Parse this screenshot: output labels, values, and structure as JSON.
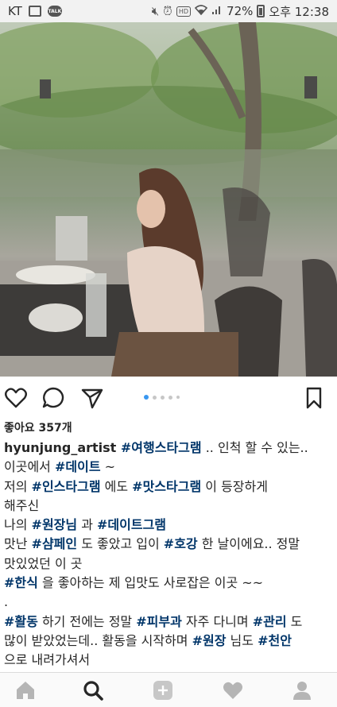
{
  "status_bar": {
    "carrier": "KT",
    "talk_badge": "TALK",
    "battery": "72%",
    "hd_label": "HD",
    "time": "오후 12:38",
    "icons": [
      "gallery-icon",
      "talk-icon",
      "mute-icon",
      "alarm-icon",
      "wifi-icon",
      "signal-icon",
      "battery-icon"
    ]
  },
  "post": {
    "carousel": {
      "count": 5,
      "active": 1
    },
    "likes": "좋아요 357개",
    "username": "hyunjung_artist",
    "caption_lines": [
      [
        {
          "t": "",
          "tag": false
        },
        {
          "t": "#여행스타그램",
          "tag": true
        },
        {
          "t": " .. 인척 할 수 있는..",
          "tag": false
        }
      ],
      [
        {
          "t": "이곳에서 ",
          "tag": false
        },
        {
          "t": "#데이트",
          "tag": true
        },
        {
          "t": " ~",
          "tag": false
        }
      ],
      [
        {
          "t": "저의 ",
          "tag": false
        },
        {
          "t": "#인스타그램",
          "tag": true
        },
        {
          "t": " 에도 ",
          "tag": false
        },
        {
          "t": "#맛스타그램",
          "tag": true
        },
        {
          "t": " 이 등장하게",
          "tag": false
        }
      ],
      [
        {
          "t": "해주신",
          "tag": false
        }
      ],
      [
        {
          "t": "나의 ",
          "tag": false
        },
        {
          "t": "#원장님",
          "tag": true
        },
        {
          "t": " 과 ",
          "tag": false
        },
        {
          "t": "#데이트그램",
          "tag": true
        }
      ],
      [
        {
          "t": "맛난 ",
          "tag": false
        },
        {
          "t": "#샴페인",
          "tag": true
        },
        {
          "t": " 도 좋았고 입이 ",
          "tag": false
        },
        {
          "t": "#호강",
          "tag": true
        },
        {
          "t": " 한 날이에요.. 정말",
          "tag": false
        }
      ],
      [
        {
          "t": "맛있었던 이 곳",
          "tag": false
        }
      ],
      [
        {
          "t": "#한식",
          "tag": true
        },
        {
          "t": " 을 좋아하는 제 입맛도 사로잡은 이곳 ~~",
          "tag": false
        }
      ],
      [
        {
          "t": ".",
          "tag": false
        }
      ],
      [
        {
          "t": "#활동",
          "tag": true
        },
        {
          "t": " 하기 전에는 정말 ",
          "tag": false
        },
        {
          "t": "#피부과",
          "tag": true
        },
        {
          "t": " 자주 다니며 ",
          "tag": false
        },
        {
          "t": "#관리",
          "tag": true
        },
        {
          "t": " 도",
          "tag": false
        }
      ],
      [
        {
          "t": "많이 받았었는데.. 활동을 시작하며 ",
          "tag": false
        },
        {
          "t": "#원장",
          "tag": true
        },
        {
          "t": " 님도 ",
          "tag": false
        },
        {
          "t": "#천안",
          "tag": true
        }
      ],
      [
        {
          "t": "으로 내려가셔서",
          "tag": false
        }
      ]
    ],
    "action_icons": [
      "heart-icon",
      "comment-icon",
      "share-icon",
      "bookmark-icon"
    ]
  },
  "bottom_nav": [
    "home-icon",
    "search-icon",
    "add-icon",
    "activity-heart-icon",
    "profile-icon"
  ],
  "colors": {
    "hashtag": "#003569",
    "text": "#262626",
    "carousel_active": "#3897f0",
    "nav_inactive": "#b5b5b5"
  }
}
